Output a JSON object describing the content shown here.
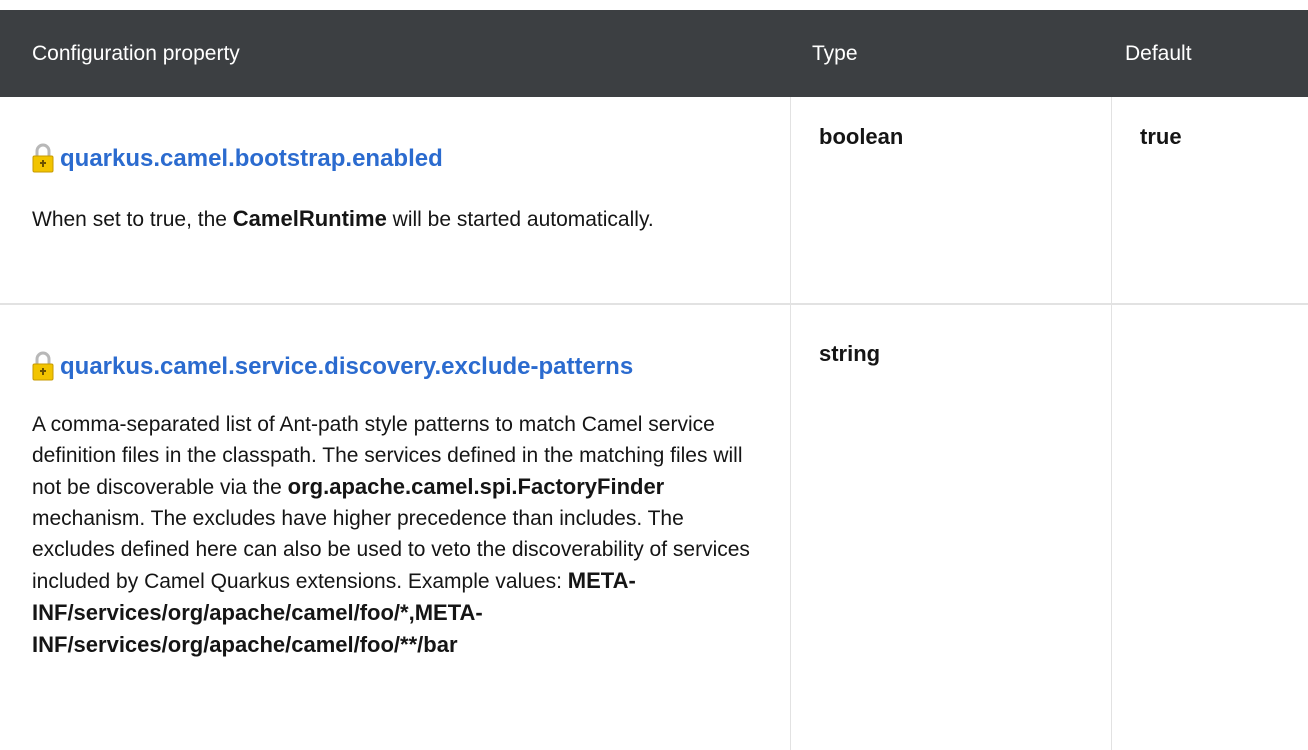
{
  "table": {
    "headers": {
      "property": "Configuration property",
      "type": "Type",
      "default": "Default"
    },
    "rows": [
      {
        "name": "quarkus.camel.bootstrap.enabled",
        "desc_prefix": "When set to true, the ",
        "desc_code": "CamelRuntime",
        "desc_suffix": " will be started automatically.",
        "type": "boolean",
        "default": "true",
        "icon": "lock-icon"
      },
      {
        "name": "quarkus.camel.service.discovery.exclude-patterns",
        "desc_part1": "A comma-separated list of Ant-path style patterns to match Camel service definition files in the classpath. The services defined in the matching files will not be discoverable via the ",
        "desc_code1": "org.apache.camel.spi.FactoryFinder",
        "desc_part2": " mechanism. The excludes have higher precedence than includes. The excludes defined here can also be used to veto the discoverability of services included by Camel Quarkus extensions. Example values: ",
        "desc_code2": "META-INF/services/org/apache/camel/foo/*,META-INF/services/org/apache/camel/foo/**/bar",
        "type": "string",
        "default": "",
        "icon": "lock-icon"
      }
    ]
  },
  "colors": {
    "header_bg": "#3c3f42",
    "link": "#2b6bcf",
    "lock_body": "#f2c400",
    "lock_shackle": "#b8b8b8"
  }
}
